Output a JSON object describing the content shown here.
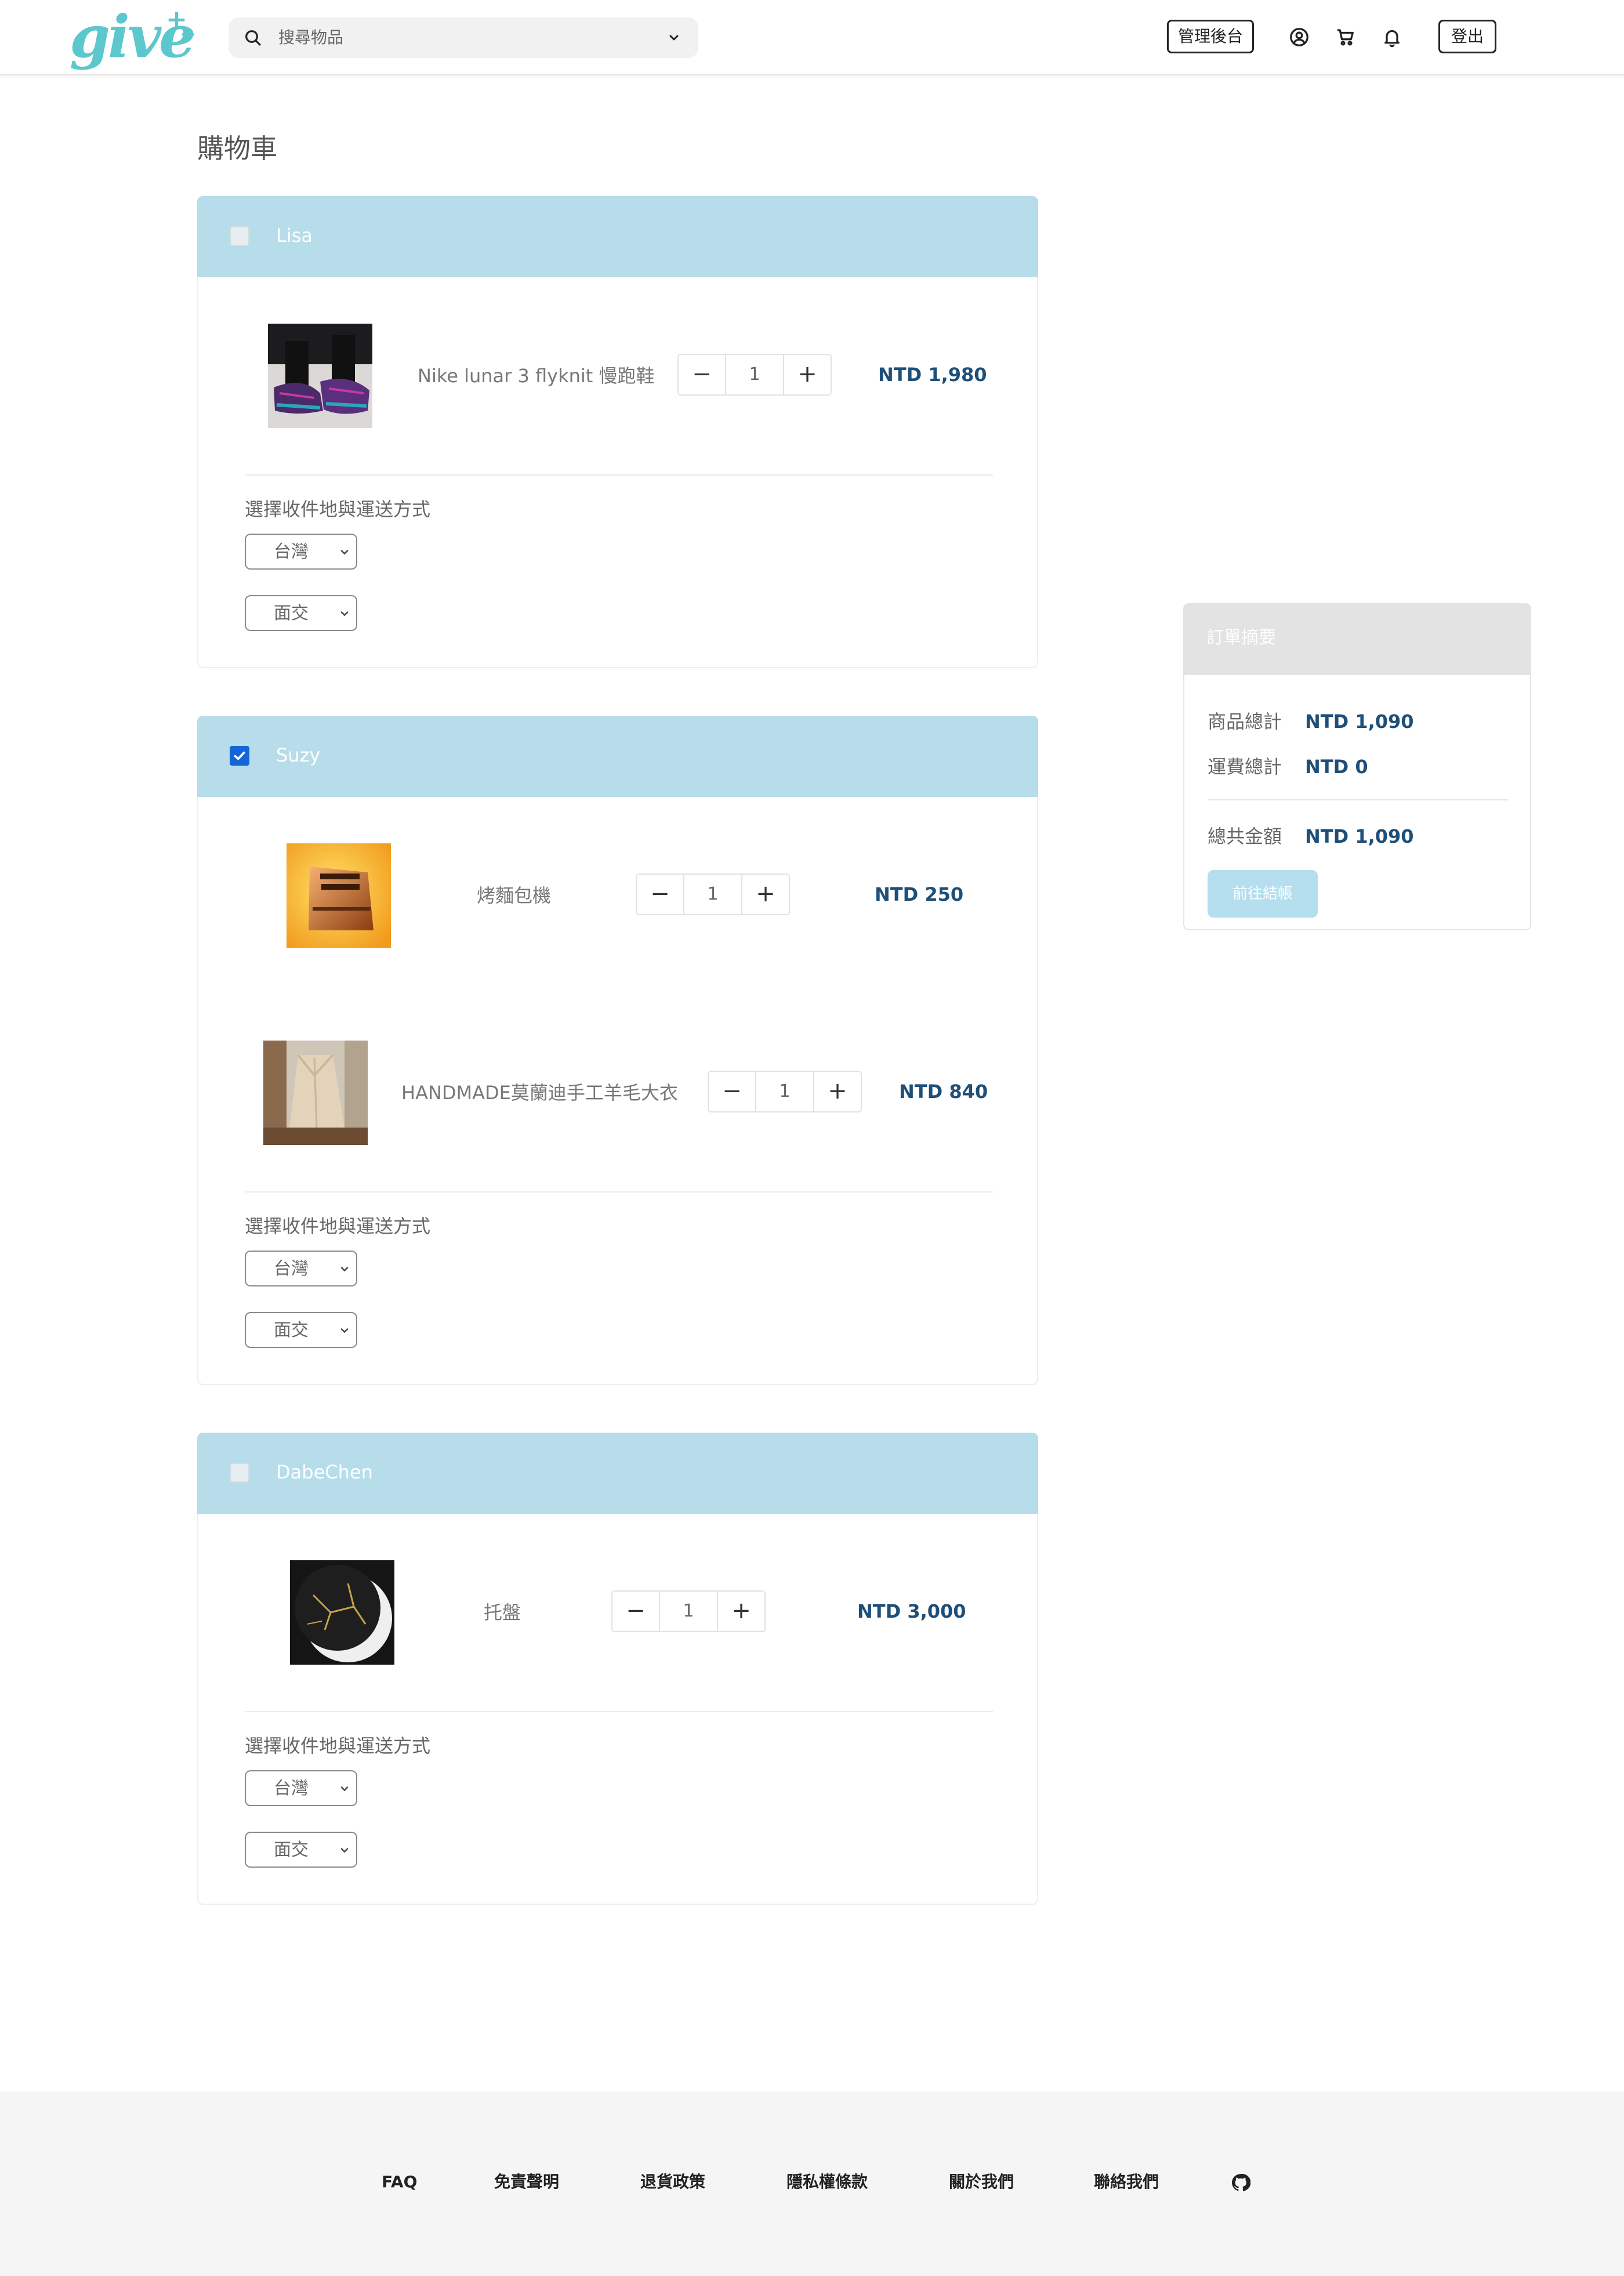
{
  "header": {
    "logo_text": "give",
    "logo_plus": "+",
    "search_placeholder": "搜尋物品",
    "admin_label": "管理後台",
    "logout_label": "登出",
    "icons": [
      "user-circle-icon",
      "cart-icon",
      "bell-icon"
    ]
  },
  "page": {
    "title": "購物車"
  },
  "sellers": [
    {
      "name": "Lisa",
      "checked": false,
      "items": [
        {
          "name": "Nike lunar 3 flyknit 慢跑鞋",
          "qty": "1",
          "price": "NTD 1,980"
        }
      ],
      "shipping_label": "選擇收件地與運送方式",
      "location": "台灣",
      "method": "面交"
    },
    {
      "name": "Suzy",
      "checked": true,
      "items": [
        {
          "name": "烤麵包機",
          "qty": "1",
          "price": "NTD 250"
        },
        {
          "name": "HANDMADE莫蘭迪手工羊毛大衣",
          "qty": "1",
          "price": "NTD 840"
        }
      ],
      "shipping_label": "選擇收件地與運送方式",
      "location": "台灣",
      "method": "面交"
    },
    {
      "name": "DabeChen",
      "checked": false,
      "items": [
        {
          "name": "托盤",
          "qty": "1",
          "price": "NTD 3,000"
        }
      ],
      "shipping_label": "選擇收件地與運送方式",
      "location": "台灣",
      "method": "面交"
    }
  ],
  "qty_controls": {
    "minus": "−",
    "plus": "+"
  },
  "summary": {
    "title": "訂單摘要",
    "subtotal_label": "商品總計",
    "subtotal_value": "NTD 1,090",
    "shipping_label": "運費總計",
    "shipping_value": "NTD 0",
    "total_label": "總共金額",
    "total_value": "NTD 1,090",
    "checkout_label": "前往結帳"
  },
  "footer": {
    "links": [
      "FAQ",
      "免責聲明",
      "退貨政策",
      "隱私權條款",
      "關於我們",
      "聯絡我們"
    ],
    "github_icon": "github-icon"
  },
  "colors": {
    "brand": "#5cc7cc",
    "seller_header": "#b7dcea",
    "price": "#1e4f78",
    "checkbox_checked": "#1565d8",
    "checkout_button": "#b5dfee",
    "footer_bg": "#f5f5f5"
  }
}
